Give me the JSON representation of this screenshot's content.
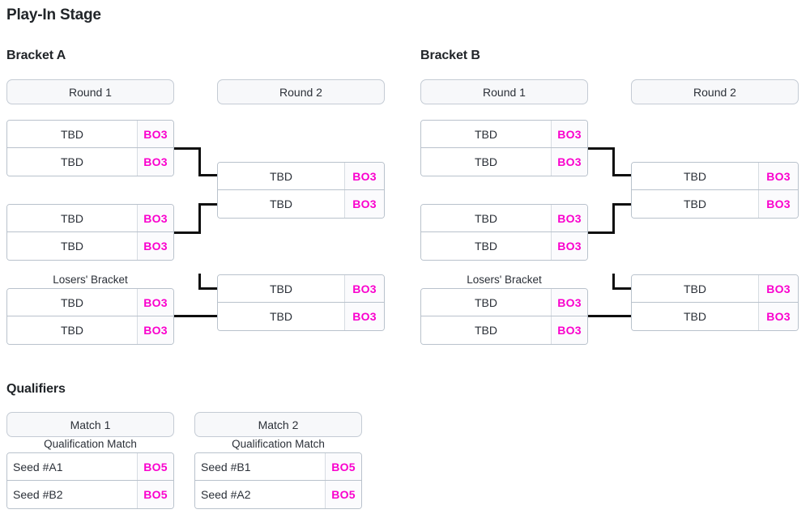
{
  "page": {
    "stage_title": "Play-In Stage",
    "qualifiers_title": "Qualifiers"
  },
  "brackets": [
    {
      "title": "Bracket A",
      "rounds": [
        {
          "label": "Round 1"
        },
        {
          "label": "Round 2"
        }
      ],
      "losers_caption": "Losers' Bracket",
      "matches": {
        "r1_m1": {
          "p1": "TBD",
          "s1": "BO3",
          "p2": "TBD",
          "s2": "BO3"
        },
        "r1_m2": {
          "p1": "TBD",
          "s1": "BO3",
          "p2": "TBD",
          "s2": "BO3"
        },
        "r1_lb": {
          "p1": "TBD",
          "s1": "BO3",
          "p2": "TBD",
          "s2": "BO3"
        },
        "r2_m1": {
          "p1": "TBD",
          "s1": "BO3",
          "p2": "TBD",
          "s2": "BO3"
        },
        "r2_lb": {
          "p1": "TBD",
          "s1": "BO3",
          "p2": "TBD",
          "s2": "BO3"
        }
      }
    },
    {
      "title": "Bracket B",
      "rounds": [
        {
          "label": "Round 1"
        },
        {
          "label": "Round 2"
        }
      ],
      "losers_caption": "Losers' Bracket",
      "matches": {
        "r1_m1": {
          "p1": "TBD",
          "s1": "BO3",
          "p2": "TBD",
          "s2": "BO3"
        },
        "r1_m2": {
          "p1": "TBD",
          "s1": "BO3",
          "p2": "TBD",
          "s2": "BO3"
        },
        "r1_lb": {
          "p1": "TBD",
          "s1": "BO3",
          "p2": "TBD",
          "s2": "BO3"
        },
        "r2_m1": {
          "p1": "TBD",
          "s1": "BO3",
          "p2": "TBD",
          "s2": "BO3"
        },
        "r2_lb": {
          "p1": "TBD",
          "s1": "BO3",
          "p2": "TBD",
          "s2": "BO3"
        }
      }
    }
  ],
  "qualifiers": [
    {
      "header": "Match 1",
      "caption": "Qualification Match",
      "p1": "Seed #A1",
      "s1": "BO5",
      "p2": "Seed #B2",
      "s2": "BO5"
    },
    {
      "header": "Match 2",
      "caption": "Qualification Match",
      "p1": "Seed #B1",
      "s1": "BO5",
      "p2": "Seed #A2",
      "s2": "BO5"
    }
  ],
  "colors": {
    "score_text": "#fa00cd",
    "header_bg": "#f7f8fa",
    "border": "#b9c2cc",
    "connector": "#0f0f0f",
    "text": "#2b3038"
  }
}
